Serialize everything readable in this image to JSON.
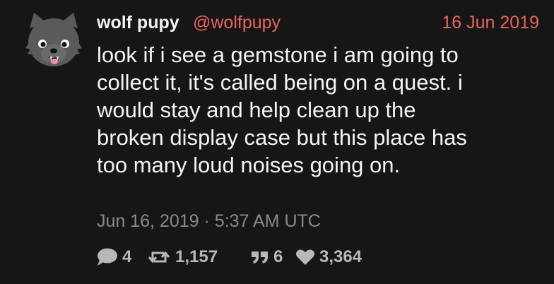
{
  "author": {
    "display_name": "wolf pupy",
    "handle": "@wolfpupy",
    "avatar_icon": "wolf-pup-icon"
  },
  "tweet": {
    "date_short": "16 Jun 2019",
    "text": "look if i see a gemstone i am going to\ncollect it, it's called being on a quest. i\nwould stay and help clean up the\nbroken display case but this place has\ntoo many loud noises going on.",
    "timestamp": "Jun 16, 2019 · 5:37 AM UTC"
  },
  "stats": {
    "replies": "4",
    "retweets": "1,157",
    "quotes": "6",
    "likes": "3,364"
  },
  "icons": {
    "replies": "comment-icon",
    "retweets": "retweet-icon",
    "quotes": "quote-icon",
    "likes": "heart-icon"
  },
  "colors": {
    "background": "#161616",
    "accent": "#e8645d",
    "muted": "#8a8a8a"
  }
}
